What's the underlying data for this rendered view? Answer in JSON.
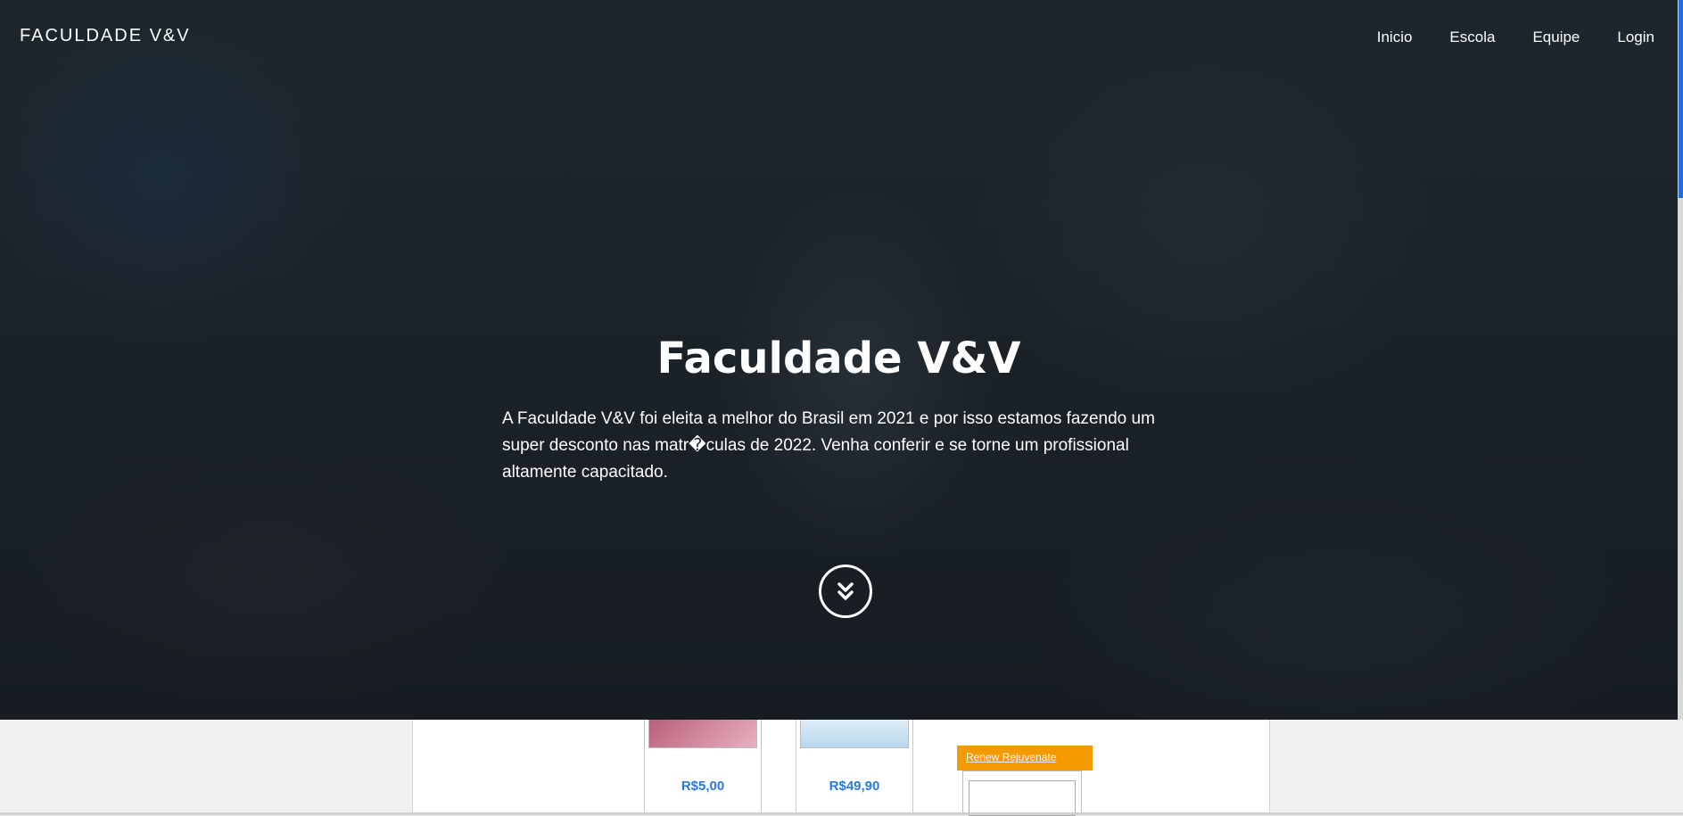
{
  "header": {
    "brand": "FACULDADE V&V",
    "nav": [
      "Inicio",
      "Escola",
      "Equipe",
      "Login"
    ]
  },
  "hero": {
    "title": "Faculdade V&V",
    "description": "A Faculdade V&V foi eleita a melhor do Brasil em 2021 e por isso estamos fazendo um super desconto nas matr�culas de 2022. Venha conferir e se torne um profissional altamente capacitado.",
    "scroll_icon": "double-chevron-down-icon"
  },
  "products": {
    "cards": [
      {
        "price": "R$5,00"
      },
      {
        "price": "R$49,90"
      }
    ],
    "promo_label": "Renew Rejuvenate"
  },
  "colors": {
    "accent": "#2a7ad6",
    "promo": "#f29a00",
    "scrollbar": "#1f6fd6"
  }
}
